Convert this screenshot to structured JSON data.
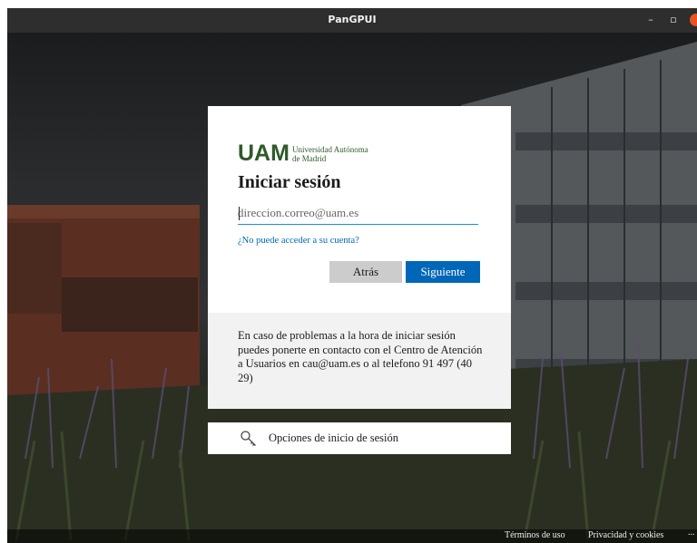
{
  "window": {
    "title": "PanGPUI",
    "minimize_glyph": "–",
    "maximize_glyph": "▫"
  },
  "brand": {
    "logo_letters": "UAM",
    "line1": "Universidad Autónoma",
    "line2": "de Madrid",
    "color": "#2f5a2a"
  },
  "login": {
    "heading": "Iniciar sesión",
    "email_placeholder": "direccion.correo@uam.es",
    "email_value": "",
    "cant_access_link": "¿No puede acceder a su cuenta?",
    "back_label": "Atrás",
    "next_label": "Siguiente",
    "help_text": "En caso de problemas a la hora de iniciar sesión puedes ponerte en contacto con el Centro de Atención a Usuarios en cau@uam.es o al telefono 91 497 (40 29)"
  },
  "options": {
    "label": "Opciones de inicio de sesión",
    "icon": "key-icon"
  },
  "footer": {
    "terms": "Términos de uso",
    "privacy": "Privacidad y cookies",
    "more": "..."
  },
  "colors": {
    "accent": "#0067b8",
    "titlebar": "#2e2e2e",
    "close_button": "#e95420"
  }
}
